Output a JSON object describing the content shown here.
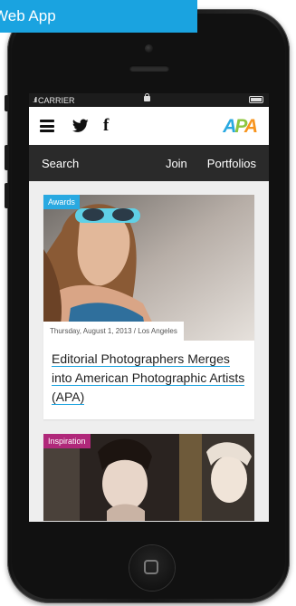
{
  "banner": {
    "text": "Web App"
  },
  "statusbar": {
    "carrier": "CARRIER"
  },
  "topbar": {
    "logo": "APA",
    "facebook_glyph": "f"
  },
  "nav": {
    "search": "Search",
    "join": "Join",
    "portfolios": "Portfolios"
  },
  "articles": [
    {
      "tag": "Awards",
      "tag_color": "#29a9e1",
      "meta": "Thursday, August 1, 2013 / Los Angeles",
      "title": "Editorial Photographers Merges into American Photographic Artists (APA)"
    },
    {
      "tag": "Inspiration",
      "tag_color": "#b0287a"
    }
  ],
  "colors": {
    "accent": "#1aa3e0",
    "nav_bg": "#2a2a2a",
    "logo_a1": "#29a9e1",
    "logo_p": "#8dc63f",
    "logo_a2": "#f7941d"
  }
}
